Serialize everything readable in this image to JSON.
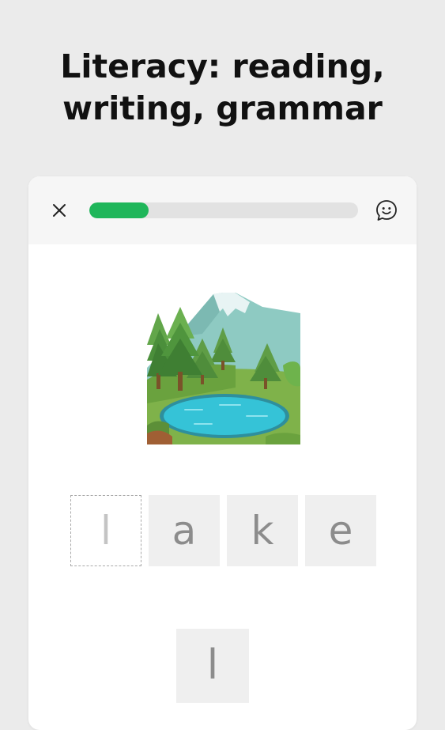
{
  "headline": {
    "line1": "Literacy: reading,",
    "line2": "writing, grammar"
  },
  "topbar": {
    "close_icon": "close-icon",
    "chat_icon": "chat-bubble-smile-icon",
    "progress": 0.22,
    "colors": {
      "progress_fill": "#1fb65a",
      "progress_track": "#e2e2e2"
    }
  },
  "exercise": {
    "image_icon": "lake-mountain-illustration",
    "slots": [
      "l",
      "a",
      "k",
      "e"
    ],
    "tile": "l"
  }
}
